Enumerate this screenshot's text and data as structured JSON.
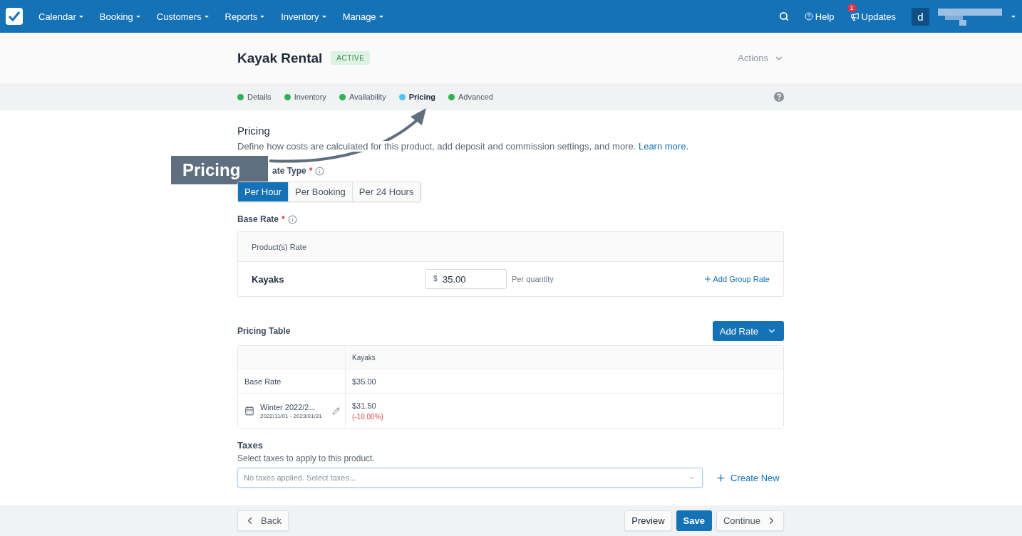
{
  "nav": {
    "menus": [
      "Calendar",
      "Booking",
      "Customers",
      "Reports",
      "Inventory",
      "Manage"
    ],
    "help": "Help",
    "updates": {
      "label": "Updates",
      "badge": "1"
    },
    "avatar": "d"
  },
  "header": {
    "title": "Kayak Rental",
    "status": "ACTIVE",
    "actions": "Actions"
  },
  "steps": [
    {
      "label": "Details",
      "selected": false,
      "color": "#2fb350"
    },
    {
      "label": "Inventory",
      "selected": false,
      "color": "#2fb350"
    },
    {
      "label": "Availability",
      "selected": false,
      "color": "#2fb350"
    },
    {
      "label": "Pricing",
      "selected": true,
      "color": "#4fc3f7"
    },
    {
      "label": "Advanced",
      "selected": false,
      "color": "#2fb350"
    }
  ],
  "callout": "Pricing",
  "section": {
    "title": "Pricing",
    "description": "Define how costs are calculated for this product, add deposit and commission settings, and more.",
    "link": "Learn more."
  },
  "rate_type": {
    "label": "ate Type",
    "required": "*",
    "options": [
      {
        "label": "Per Hour",
        "selected": true
      },
      {
        "label": "Per Booking",
        "selected": false
      },
      {
        "label": "Per 24 Hours",
        "selected": false
      }
    ]
  },
  "base_rate": {
    "label": "Base Rate",
    "required": "*",
    "header": "Product(s) Rate",
    "product": "Kayaks",
    "currency": "$",
    "value": "35.00",
    "unit": "Per quantity",
    "add_group": "Add Group Rate"
  },
  "pricing_table": {
    "title": "Pricing Table",
    "add_rate": "Add Rate",
    "columns": [
      "Kayaks"
    ],
    "rows": [
      {
        "kind": "base",
        "name": "Base Rate",
        "price": "$35.00"
      },
      {
        "kind": "season",
        "name": "Winter 2022/2...",
        "dates": "2022/11/01 - 2023/01/31",
        "price": "$31.50",
        "change": "(-10.00%)"
      }
    ]
  },
  "taxes": {
    "title": "Taxes",
    "description": "Select taxes to apply to this product.",
    "placeholder": "No taxes applied. Select taxes...",
    "create": "Create New"
  },
  "footer": {
    "back": "Back",
    "preview": "Preview",
    "save": "Save",
    "continue": "Continue"
  }
}
